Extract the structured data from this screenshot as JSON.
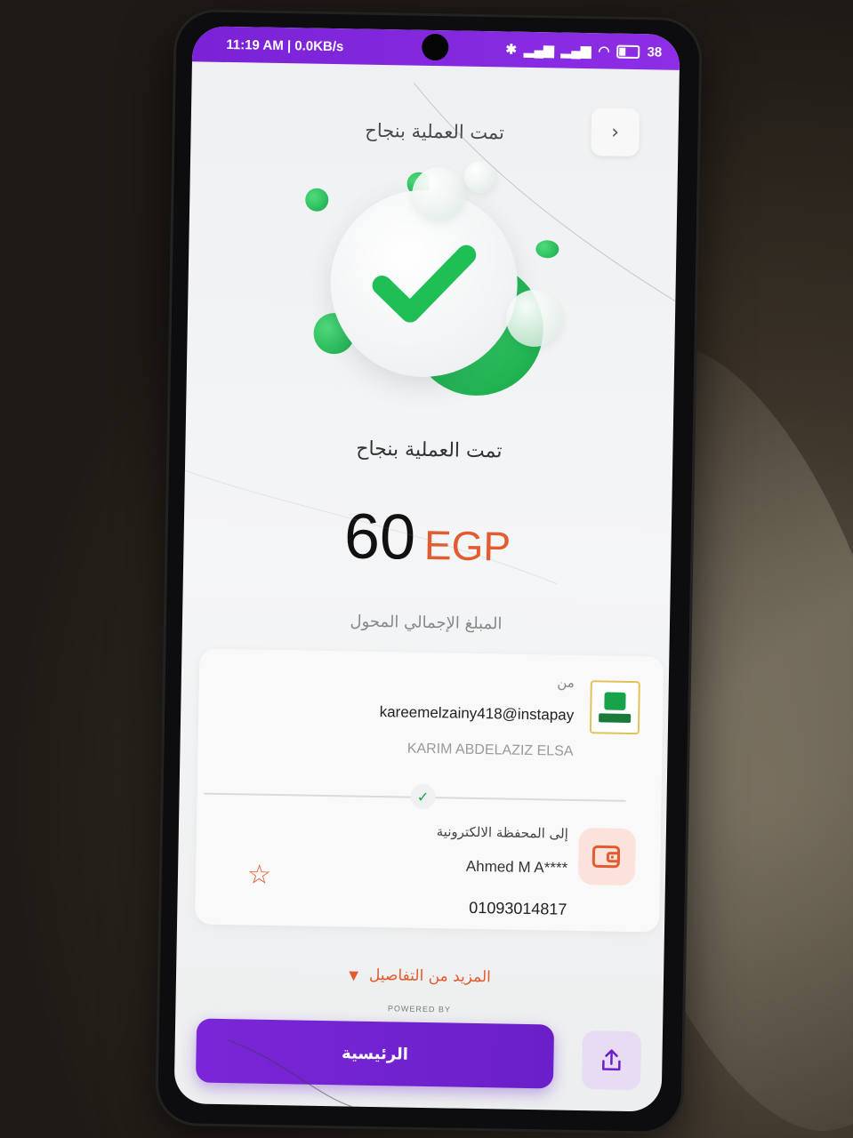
{
  "status_bar": {
    "time_speed": "11:19 AM | 0.0KB/s",
    "battery": "38"
  },
  "header": {
    "title": "تمت العملية بنجاح",
    "back_glyph": "›"
  },
  "result": {
    "status_text": "تمت العملية بنجاح",
    "amount": "60",
    "currency": "EGP",
    "amount_label": "المبلغ الإجمالي المحول"
  },
  "from": {
    "label": "من",
    "handle": "kareemelzainy418@instapay",
    "name": "KARIM ABDELAZIZ ELSA"
  },
  "to": {
    "label": "إلى  المحفظة الالكترونية",
    "name": "Ahmed M A****",
    "phone": "01093014817"
  },
  "more_details": "المزيد من التفاصيل",
  "powered_by": "POWERED BY",
  "buttons": {
    "home": "الرئيسية"
  },
  "icons": {
    "back": "chevron-right-icon",
    "success": "check-icon",
    "bank": "bank-logo-icon",
    "wallet": "wallet-icon",
    "favorite": "star-icon",
    "expand": "chevron-down-icon",
    "share": "share-icon"
  },
  "colors": {
    "primary_purple": "#7a26d8",
    "accent_orange": "#e35b2f",
    "success_green": "#1aa34a"
  }
}
